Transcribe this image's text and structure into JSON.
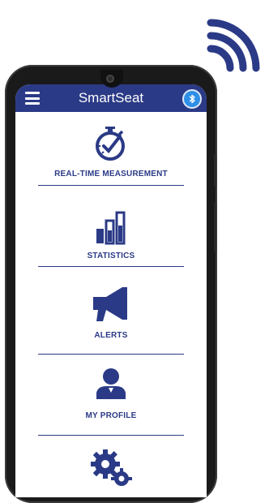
{
  "app": {
    "title": "SmartSeat"
  },
  "icons": {
    "wifi": "wifi-signal-icon",
    "menu": "hamburger-menu-icon",
    "bluetooth": "bluetooth-icon"
  },
  "menu": {
    "items": [
      {
        "label": "REAL-TIME MEASUREMENT",
        "icon": "stopwatch-check-icon"
      },
      {
        "label": "STATISTICS",
        "icon": "bar-chart-icon"
      },
      {
        "label": "ALERTS",
        "icon": "megaphone-icon"
      },
      {
        "label": "MY PROFILE",
        "icon": "user-icon"
      },
      {
        "label": "",
        "icon": "gears-icon"
      }
    ]
  },
  "colors": {
    "primary": "#2b3a86",
    "accent": "#2f8fe6",
    "phone_body": "#1a1a1a"
  }
}
